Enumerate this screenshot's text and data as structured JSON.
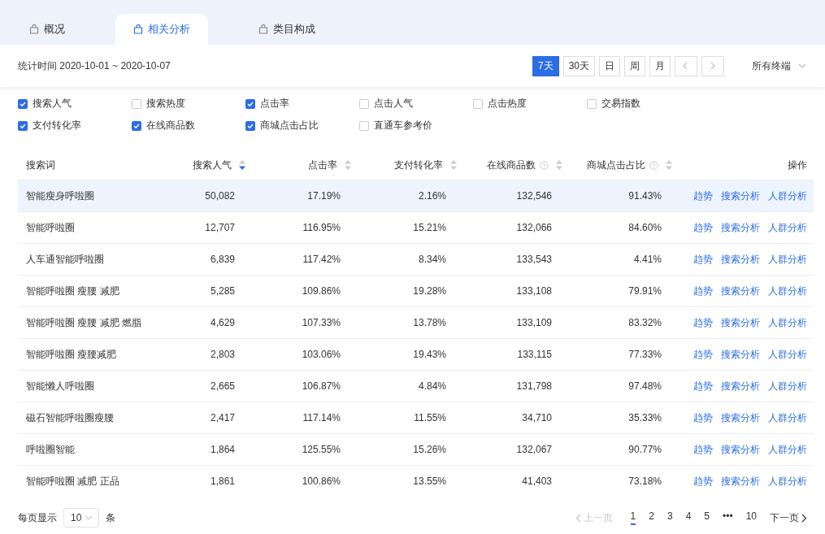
{
  "tabs": [
    {
      "label": "概况",
      "selected": false
    },
    {
      "label": "相关分析",
      "selected": true
    },
    {
      "label": "类目构成",
      "selected": false
    }
  ],
  "toolbar": {
    "date_range": "统计时间 2020-10-01 ~ 2020-10-07",
    "periods": [
      {
        "label": "7天",
        "selected": true
      },
      {
        "label": "30天",
        "selected": false
      },
      {
        "label": "日",
        "selected": false
      },
      {
        "label": "周",
        "selected": false
      },
      {
        "label": "月",
        "selected": false
      }
    ],
    "device_select": "所有终端"
  },
  "metrics": [
    {
      "label": "搜索人气",
      "checked": true
    },
    {
      "label": "搜索热度",
      "checked": false
    },
    {
      "label": "点击率",
      "checked": true
    },
    {
      "label": "点击人气",
      "checked": false
    },
    {
      "label": "点击热度",
      "checked": false
    },
    {
      "label": "交易指数",
      "checked": false
    },
    {
      "label": "支付转化率",
      "checked": true
    },
    {
      "label": "在线商品数",
      "checked": true
    },
    {
      "label": "商城点击占比",
      "checked": true
    },
    {
      "label": "直通车参考价",
      "checked": false
    }
  ],
  "table": {
    "columns": [
      {
        "label": "搜索词"
      },
      {
        "label": "搜索人气",
        "help": false,
        "sorted": true
      },
      {
        "label": "点击率",
        "help": false,
        "sorted": false
      },
      {
        "label": "支付转化率",
        "help": false,
        "sorted": false
      },
      {
        "label": "在线商品数",
        "help": true,
        "sorted": false
      },
      {
        "label": "商城点击占比",
        "help": true,
        "sorted": false
      },
      {
        "label": "操作"
      }
    ],
    "rows": [
      {
        "cells": [
          "智能瘦身呼啦圈",
          "50,082",
          "17.19%",
          "2.16%",
          "132,546",
          "91.43%"
        ],
        "actions": [
          "趋势",
          "搜索分析",
          "人群分析"
        ],
        "selected": true
      },
      {
        "cells": [
          "智能呼啦圈",
          "12,707",
          "116.95%",
          "15.21%",
          "132,066",
          "84.60%"
        ],
        "actions": [
          "趋势",
          "搜索分析",
          "人群分析"
        ],
        "selected": false
      },
      {
        "cells": [
          "人车通智能呼啦圈",
          "6,839",
          "117.42%",
          "8.34%",
          "133,543",
          "4.41%"
        ],
        "actions": [
          "趋势",
          "搜索分析",
          "人群分析"
        ],
        "selected": false
      },
      {
        "cells": [
          "智能呼啦圈 瘦腰 减肥",
          "5,285",
          "109.86%",
          "19.28%",
          "133,108",
          "79.91%"
        ],
        "actions": [
          "趋势",
          "搜索分析",
          "人群分析"
        ],
        "selected": false
      },
      {
        "cells": [
          "智能呼啦圈 瘦腰 减肥 燃脂",
          "4,629",
          "107.33%",
          "13.78%",
          "133,109",
          "83.32%"
        ],
        "actions": [
          "趋势",
          "搜索分析",
          "人群分析"
        ],
        "selected": false
      },
      {
        "cells": [
          "智能呼啦圈 瘦腰减肥",
          "2,803",
          "103.06%",
          "19.43%",
          "133,115",
          "77.33%"
        ],
        "actions": [
          "趋势",
          "搜索分析",
          "人群分析"
        ],
        "selected": false
      },
      {
        "cells": [
          "智能懒人呼啦圈",
          "2,665",
          "106.87%",
          "4.84%",
          "131,798",
          "97.48%"
        ],
        "actions": [
          "趋势",
          "搜索分析",
          "人群分析"
        ],
        "selected": false
      },
      {
        "cells": [
          "磁石智能呼啦圈瘦腰",
          "2,417",
          "117.14%",
          "11.55%",
          "34,710",
          "35.33%"
        ],
        "actions": [
          "趋势",
          "搜索分析",
          "人群分析"
        ],
        "selected": false
      },
      {
        "cells": [
          "呼啦圈智能",
          "1,864",
          "125.55%",
          "15.26%",
          "132,067",
          "90.77%"
        ],
        "actions": [
          "趋势",
          "搜索分析",
          "人群分析"
        ],
        "selected": false
      },
      {
        "cells": [
          "智能呼啦圈 减肥 正品",
          "1,861",
          "100.86%",
          "13.55%",
          "41,403",
          "73.18%"
        ],
        "actions": [
          "趋势",
          "搜索分析",
          "人群分析"
        ],
        "selected": false
      }
    ]
  },
  "footer": {
    "page_size_label": "每页显示",
    "page_size": "10",
    "page_size_unit": "条",
    "prev": {
      "label": "上一页",
      "disabled": true
    },
    "pages": [
      {
        "label": "1",
        "selected": true
      },
      {
        "label": "2",
        "selected": false
      },
      {
        "label": "3",
        "selected": false
      },
      {
        "label": "4",
        "selected": false
      },
      {
        "label": "5",
        "selected": false
      },
      {
        "label": "•••",
        "selected": false
      },
      {
        "label": "10",
        "selected": false
      }
    ],
    "next": {
      "label": "下一页",
      "disabled": false
    }
  }
}
